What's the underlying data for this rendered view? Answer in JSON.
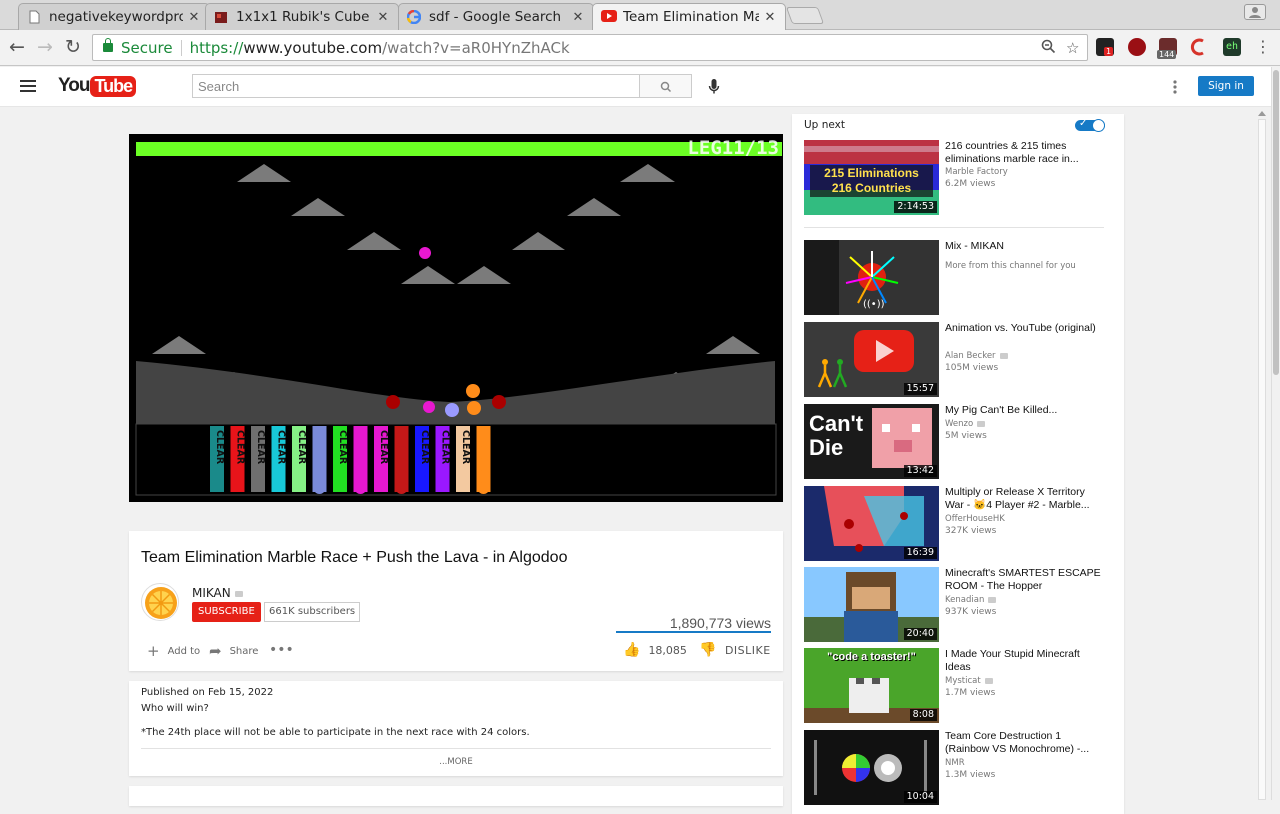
{
  "browser": {
    "tabs": [
      {
        "title": "negativekeywordpro",
        "active": false
      },
      {
        "title": "1x1x1 Rubik's Cube",
        "active": false
      },
      {
        "title": "sdf - Google Search",
        "active": false
      },
      {
        "title": "Team Elimination Ma",
        "active": true
      }
    ],
    "secure_label": "Secure",
    "url": {
      "scheme": "https://",
      "host": "www.youtube.com",
      "path": "/watch?v=aR0HYnZhACk"
    },
    "extensions": [
      {
        "name": "extension-badge-icon",
        "badge": "1",
        "color": "#222222"
      },
      {
        "name": "extension-red-circle-icon",
        "color": "#9a0f14"
      },
      {
        "name": "extension-calendar-icon",
        "badge": "144",
        "color": "#6b2c2c"
      },
      {
        "name": "extension-red-arc-icon",
        "color": "#d6332a"
      },
      {
        "name": "extension-eh-icon",
        "label": "eh",
        "color": "#1f3a2a"
      }
    ]
  },
  "youtube": {
    "logo_you": "You",
    "logo_tube": "Tube",
    "search_placeholder": "Search",
    "signin_label": "Sign in"
  },
  "player": {
    "leg_label": "LEG11/13",
    "progress_fraction": 1.0,
    "bar_color": "#6bff24",
    "slot_labels": [
      "CLEAR",
      "CLEAR",
      "CLEAR",
      "CLEAR",
      "CLEAR",
      "CLEAR",
      "CLEAR",
      "CLEAR",
      "CLEAR",
      "CLEAR",
      "CLEAR"
    ],
    "tube_colors": [
      "#1a8a8a",
      "#e8141a",
      "#6f6f6f",
      "#18c8d8",
      "#85f085",
      "#7a8ad8",
      "#22e022",
      "#e618d0",
      "#e618d0",
      "#c51818",
      "#1818ff",
      "#9a18ff",
      "#f3c9a0",
      "#ff8c1a"
    ]
  },
  "video": {
    "title": "Team Elimination Marble Race + Push the Lava - in Algodoo",
    "channel": "MIKAN",
    "subscribe_label": "SUBSCRIBE",
    "subscribers": "661K subscribers",
    "views": "1,890,773 views",
    "add_to_label": "Add to",
    "share_label": "Share",
    "likes": "18,085",
    "dislike_label": "DISLIKE"
  },
  "description": {
    "published": "Published on Feb 15, 2022",
    "line1": "Who will win?",
    "line2": "*The 24th place will not be able to participate in the next race with 24 colors.",
    "more_label": "...MORE"
  },
  "sidebar": {
    "up_next_label": "Up next",
    "autoplay_on": true,
    "items": [
      {
        "title": "216 countries & 215 times eliminations marble race in...",
        "channel": "Marble Factory",
        "verified": false,
        "views": "6.2M views",
        "duration": "2:14:53",
        "thumb_text1": "215 Eliminations",
        "thumb_text2": "216 Countries"
      },
      {
        "title": "Mix - MIKAN",
        "channel": "",
        "verified": false,
        "views": "More from this channel for you",
        "duration": ""
      },
      {
        "title": "Animation vs. YouTube (original)",
        "channel": "Alan Becker",
        "verified": true,
        "views": "105M views",
        "duration": "15:57"
      },
      {
        "title": "My Pig Can't Be Killed...",
        "channel": "Wenzo",
        "verified": true,
        "views": "5M views",
        "duration": "13:42",
        "thumb_text1": "Can't",
        "thumb_text2": "Die"
      },
      {
        "title": "Multiply or Release X Territory War - 🐱4 Player #2 - Marble...",
        "channel": "OfferHouseHK",
        "verified": false,
        "views": "327K views",
        "duration": "16:39"
      },
      {
        "title": "Minecraft's SMARTEST ESCAPE ROOM - The Hopper",
        "channel": "Kenadian",
        "verified": true,
        "views": "937K views",
        "duration": "20:40"
      },
      {
        "title": "I Made Your Stupid Minecraft Ideas",
        "channel": "Mysticat",
        "verified": true,
        "views": "1.7M views",
        "duration": "8:08",
        "thumb_text1": "\"code a toaster!\""
      },
      {
        "title": "Team Core Destruction 1 (Rainbow VS Monochrome) -...",
        "channel": "NMR",
        "verified": false,
        "views": "1.3M views",
        "duration": "10:04"
      }
    ]
  }
}
